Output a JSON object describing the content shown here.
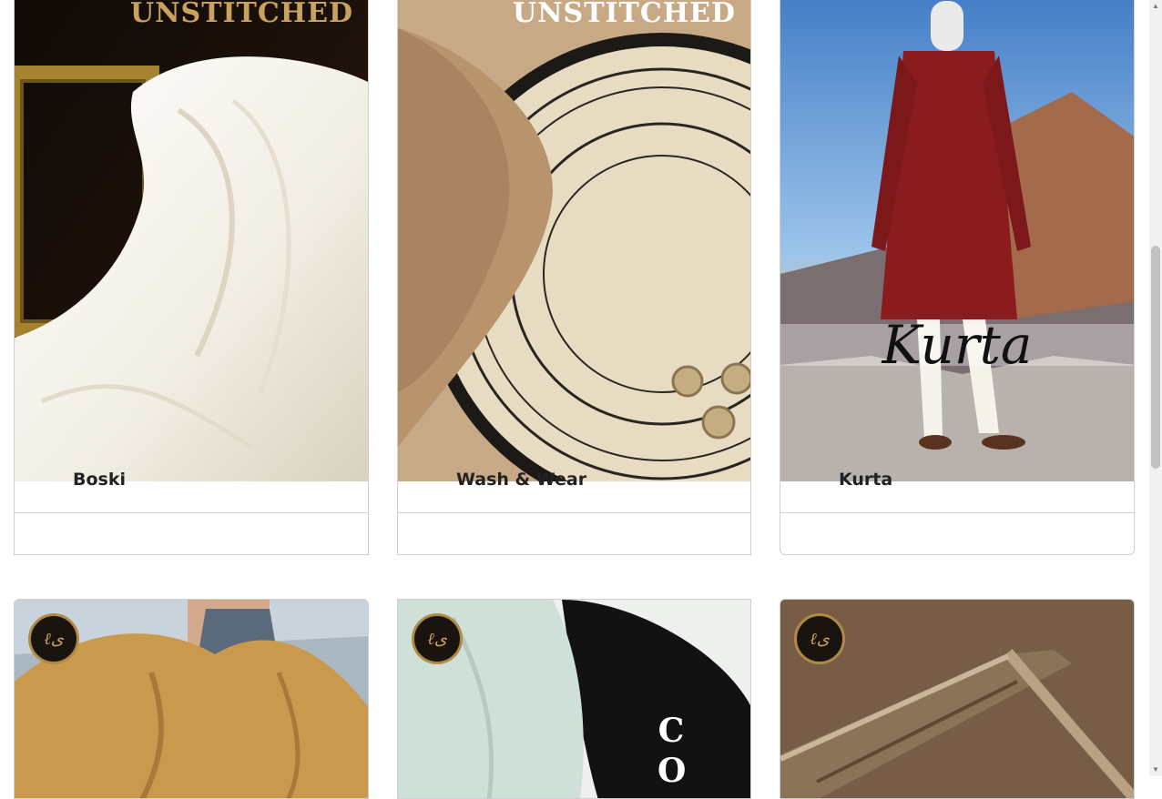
{
  "products": [
    {
      "title": "Boski",
      "banner": "UNSTITCHED"
    },
    {
      "title": "Wash & Wear",
      "banner": "UNSTITCHED"
    },
    {
      "title": "Kurta",
      "script": "Kurta"
    }
  ],
  "bottom_row": [
    {
      "name": "shawl"
    },
    {
      "name": "cotton",
      "banner": "C O"
    },
    {
      "name": "brown-fabric"
    }
  ],
  "colors": {
    "border": "#cfcfcf",
    "title": "#222222",
    "gold": "#c9a35e"
  },
  "icons": [
    "brand-logo-icon",
    "scroll-up-icon",
    "scroll-down-icon"
  ]
}
